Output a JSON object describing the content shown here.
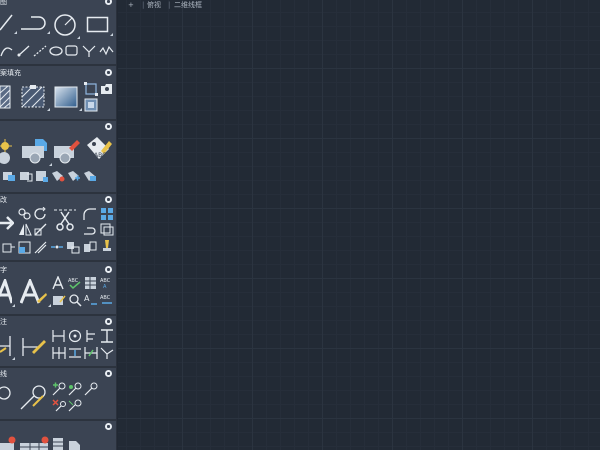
{
  "palette": {
    "sections": [
      {
        "id": "draw",
        "title": "图"
      },
      {
        "id": "hatch",
        "title": "案填充"
      },
      {
        "id": "block",
        "title": ""
      },
      {
        "id": "modify",
        "title": "改"
      },
      {
        "id": "text",
        "title": "字"
      },
      {
        "id": "dimension",
        "title": "注"
      },
      {
        "id": "leader",
        "title": "线"
      },
      {
        "id": "table",
        "title": ""
      }
    ]
  },
  "viewport": {
    "menu_button": "+",
    "view_label": "俯视",
    "style_label": "二维线框"
  },
  "colors": {
    "palette_bg": "#3b4453",
    "canvas_bg": "#222a35",
    "accent_blue": "#5aa9e6",
    "accent_red": "#e2523f",
    "accent_yellow": "#e8c24a"
  }
}
